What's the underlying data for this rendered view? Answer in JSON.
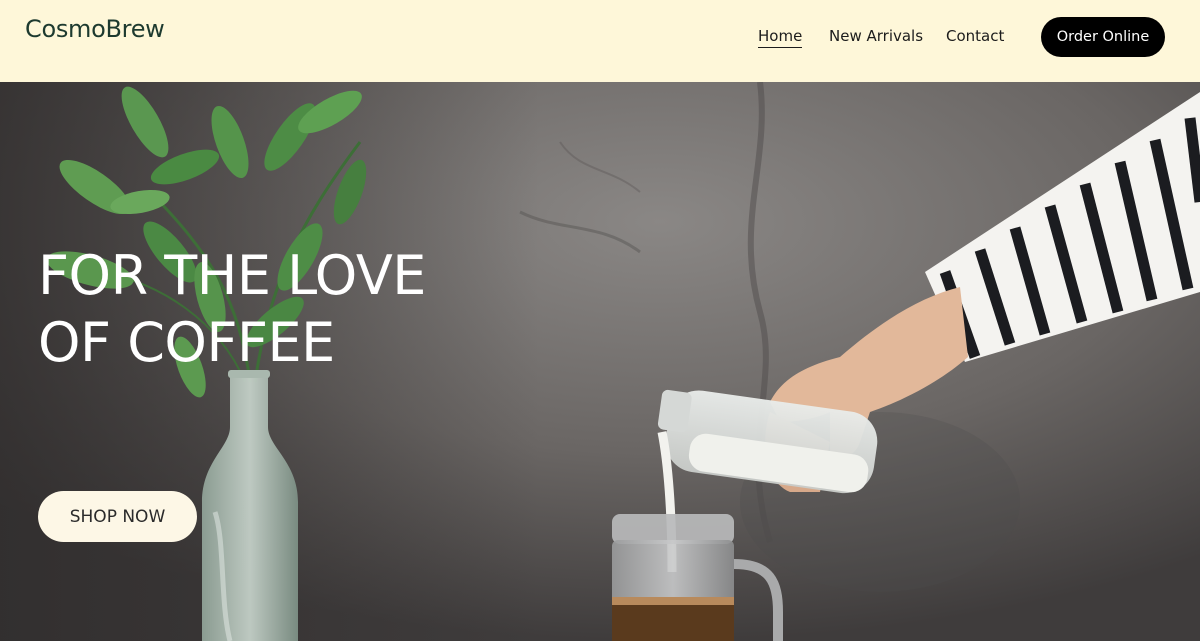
{
  "header": {
    "logo": "CosmoBrew",
    "nav": {
      "home": "Home",
      "new_arrivals": "New Arrivals",
      "contact": "Contact"
    },
    "order_button": "Order Online"
  },
  "hero": {
    "title_line1": "FOR THE LOVE",
    "title_line2": "OF COFFEE",
    "cta": "SHOP NOW"
  },
  "colors": {
    "header_bg": "#fef7d9",
    "logo_text": "#1d3a2f",
    "order_button_bg": "#000000",
    "cta_bg": "#fdf7e6"
  }
}
